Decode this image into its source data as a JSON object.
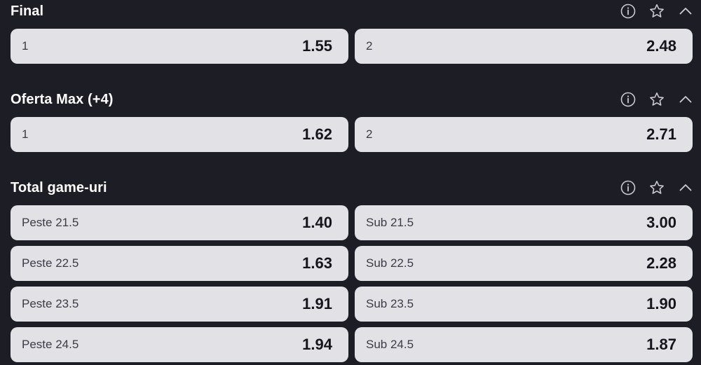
{
  "colors": {
    "background": "#1d1e25",
    "card": "#e1e1e6",
    "text_light": "#ffffff",
    "label_text": "#3b3c45",
    "value_text": "#15161c"
  },
  "icons": [
    "info-icon",
    "star-icon",
    "chevron-up-icon"
  ],
  "sections": [
    {
      "title": "Final",
      "rows": [
        [
          {
            "label": "1",
            "odd": "1.55"
          },
          {
            "label": "2",
            "odd": "2.48"
          }
        ]
      ]
    },
    {
      "title": "Oferta Max (+4)",
      "rows": [
        [
          {
            "label": "1",
            "odd": "1.62"
          },
          {
            "label": "2",
            "odd": "2.71"
          }
        ]
      ]
    },
    {
      "title": "Total game-uri",
      "rows": [
        [
          {
            "label": "Peste 21.5",
            "odd": "1.40"
          },
          {
            "label": "Sub 21.5",
            "odd": "3.00"
          }
        ],
        [
          {
            "label": "Peste 22.5",
            "odd": "1.63"
          },
          {
            "label": "Sub 22.5",
            "odd": "2.28"
          }
        ],
        [
          {
            "label": "Peste 23.5",
            "odd": "1.91"
          },
          {
            "label": "Sub 23.5",
            "odd": "1.90"
          }
        ],
        [
          {
            "label": "Peste 24.5",
            "odd": "1.94"
          },
          {
            "label": "Sub 24.5",
            "odd": "1.87"
          }
        ]
      ]
    }
  ]
}
